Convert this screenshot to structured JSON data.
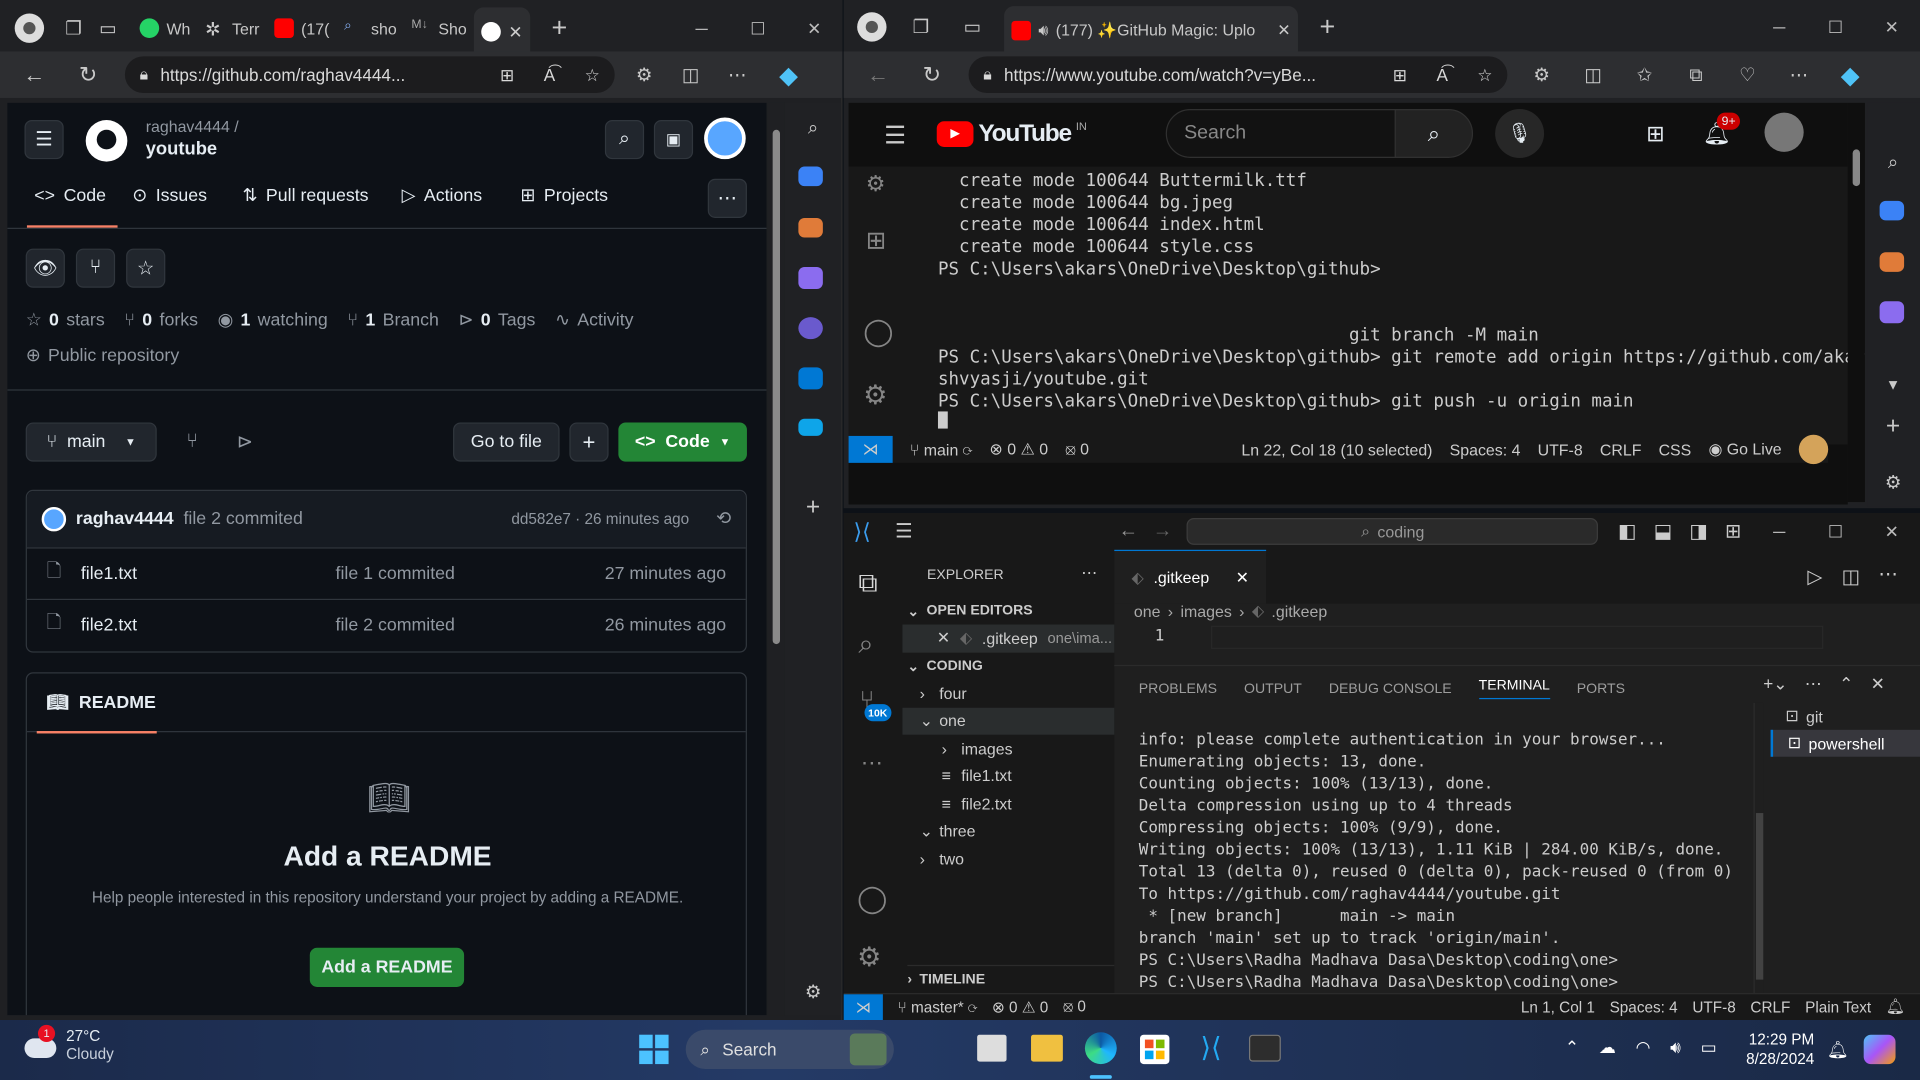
{
  "left_browser": {
    "tabs": [
      "Wh",
      "Terr",
      "(17(",
      "sho",
      "Sho"
    ],
    "url": "https://github.com/raghav4444...",
    "repo": {
      "owner": "raghav4444 /",
      "name": "youtube"
    },
    "nav": [
      "Code",
      "Issues",
      "Pull requests",
      "Actions",
      "Projects"
    ],
    "stats": {
      "stars_n": "0",
      "stars": "stars",
      "forks_n": "0",
      "forks": "forks",
      "watch_n": "1",
      "watch": "watching",
      "branch_n": "1",
      "branch": "Branch",
      "tags_n": "0",
      "tags": "Tags",
      "activity": "Activity",
      "visibility": "Public repository"
    },
    "branch": "main",
    "goto": "Go to file",
    "plus": "+",
    "code": "Code",
    "commit": {
      "user": "raghav4444",
      "msg": "file 2 commited",
      "hash": "dd582e7 · 26 minutes ago"
    },
    "files": [
      {
        "name": "file1.txt",
        "msg": "file 1 commited",
        "time": "27 minutes ago"
      },
      {
        "name": "file2.txt",
        "msg": "file 2 commited",
        "time": "26 minutes ago"
      }
    ],
    "readme": {
      "tab": "README",
      "title": "Add a README",
      "desc": "Help people interested in this repository understand your project by adding a README.",
      "btn": "Add a README"
    }
  },
  "right_browser": {
    "tab": "(177) ✨GitHub Magic: Uplo",
    "url": "https://www.youtube.com/watch?v=yBe...",
    "yt": {
      "logo": "YouTube",
      "region": "IN",
      "search": "Search",
      "notif": "9+"
    },
    "terminal_lines": [
      "  create mode 100644 Buttermilk.ttf",
      "  create mode 100644 bg.jpeg",
      "  create mode 100644 index.html",
      "  create mode 100644 style.css",
      "PS C:\\Users\\akars\\OneDrive\\Desktop\\github>",
      "",
      "",
      "                                       git branch -M main",
      "PS C:\\Users\\akars\\OneDrive\\Desktop\\github> git remote add origin https://github.com/akar",
      "shvyasji/youtube.git",
      "PS C:\\Users\\akars\\OneDrive\\Desktop\\github> git push -u origin main"
    ],
    "statusbar": {
      "branch": "main",
      "errs": "0",
      "warns": "0",
      "ports": "0",
      "pos": "Ln 22, Col 18 (10 selected)",
      "spaces": "Spaces: 4",
      "enc": "UTF-8",
      "eol": "CRLF",
      "lang": "CSS",
      "live": "Go Live"
    }
  },
  "vscode": {
    "search": "coding",
    "explorer": "EXPLORER",
    "open_editors": "OPEN EDITORS",
    "open_file": ".gitkeep",
    "open_path": "one\\ima...",
    "folder": "CODING",
    "tree": [
      {
        "label": "four",
        "indent": 1,
        "type": "closed"
      },
      {
        "label": "one",
        "indent": 1,
        "type": "open"
      },
      {
        "label": "images",
        "indent": 2,
        "type": "closed"
      },
      {
        "label": "file1.txt",
        "indent": 2,
        "type": "file"
      },
      {
        "label": "file2.txt",
        "indent": 2,
        "type": "file"
      },
      {
        "label": "three",
        "indent": 1,
        "type": "open"
      },
      {
        "label": "two",
        "indent": 1,
        "type": "closed"
      }
    ],
    "timeline": "TIMELINE",
    "tab": ".gitkeep",
    "crumbs": [
      "one",
      "images",
      ".gitkeep"
    ],
    "line_no": "1",
    "panel_tabs": [
      "PROBLEMS",
      "OUTPUT",
      "DEBUG CONSOLE",
      "TERMINAL",
      "PORTS"
    ],
    "terminal_lines": [
      "info: please complete authentication in your browser...",
      "Enumerating objects: 13, done.",
      "Counting objects: 100% (13/13), done.",
      "Delta compression using up to 4 threads",
      "Compressing objects: 100% (9/9), done.",
      "Writing objects: 100% (13/13), 1.11 KiB | 284.00 KiB/s, done.",
      "Total 13 (delta 0), reused 0 (delta 0), pack-reused 0 (from 0)",
      "To https://github.com/raghav4444/youtube.git",
      " * [new branch]      main -> main",
      "branch 'main' set up to track 'origin/main'.",
      "PS C:\\Users\\Radha Madhava Dasa\\Desktop\\coding\\one>",
      "PS C:\\Users\\Radha Madhava Dasa\\Desktop\\coding\\one> "
    ],
    "shells": [
      "git",
      "powershell"
    ],
    "badge": "10K",
    "statusbar": {
      "branch": "master*",
      "errs": "0",
      "warns": "0",
      "ports": "0",
      "pos": "Ln 1, Col 1",
      "spaces": "Spaces: 4",
      "enc": "UTF-8",
      "eol": "CRLF",
      "lang": "Plain Text"
    }
  },
  "taskbar": {
    "temp": "27°C",
    "weather": "Cloudy",
    "badge": "1",
    "search": "Search",
    "time": "12:29 PM",
    "date": "8/28/2024"
  }
}
